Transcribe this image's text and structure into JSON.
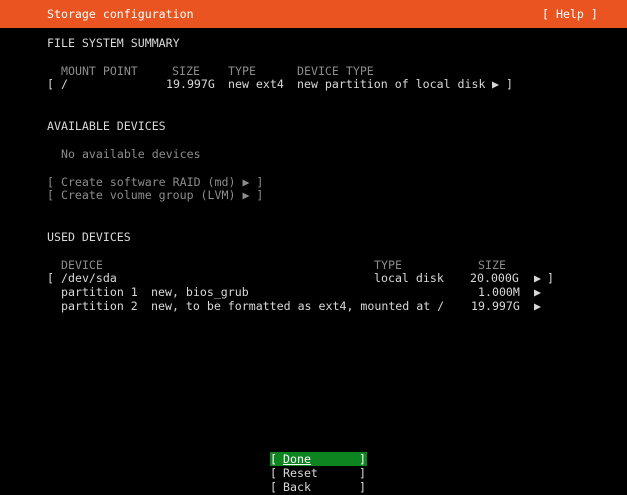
{
  "header": {
    "title": "Storage configuration",
    "help_label": "[ Help ]",
    "color": "#e95420"
  },
  "fs_summary": {
    "heading": "FILE SYSTEM SUMMARY",
    "columns": [
      "MOUNT POINT",
      "SIZE",
      "TYPE",
      "DEVICE TYPE"
    ],
    "rows": [
      {
        "open": "[",
        "mount": "/",
        "size": "19.997G",
        "type": "new ext4",
        "device_type": "new partition of local disk",
        "arrow": "▶",
        "close": "]"
      }
    ]
  },
  "available": {
    "heading": "AVAILABLE DEVICES",
    "empty_text": "No available devices",
    "actions": [
      "[ Create software RAID (md) ▶ ]",
      "[ Create volume group (LVM) ▶ ]"
    ]
  },
  "used": {
    "heading": "USED DEVICES",
    "columns": [
      "DEVICE",
      "TYPE",
      "SIZE"
    ],
    "disk": {
      "open": "[",
      "name": "/dev/sda",
      "type": "local disk",
      "size": "20.000G",
      "arrow": "▶",
      "close": "]"
    },
    "partitions": [
      {
        "name": "partition 1",
        "desc": "new, bios_grub",
        "size": "1.000M",
        "arrow": "▶"
      },
      {
        "name": "partition 2",
        "desc": "new, to be formatted as ext4, mounted at /",
        "size": "19.997G",
        "arrow": "▶"
      }
    ]
  },
  "buttons": {
    "done": {
      "open": "[",
      "label": "Done",
      "close": "]",
      "focused": true,
      "focus_color": "#0e8420"
    },
    "reset": {
      "open": "[",
      "label": "Reset",
      "close": "]"
    },
    "back": {
      "open": "[",
      "label": "Back",
      "close": "]"
    }
  }
}
